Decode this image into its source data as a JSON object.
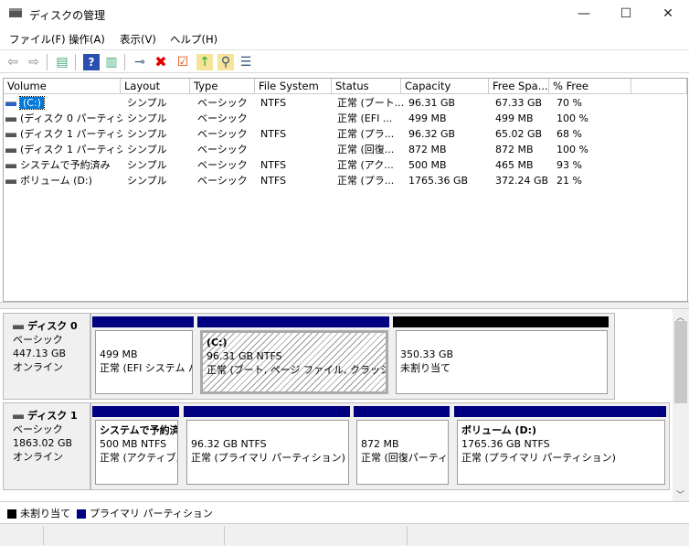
{
  "window": {
    "title": "ディスクの管理",
    "minimize": "—",
    "maximize": "☐",
    "close": "✕"
  },
  "menu": [
    "ファイル(F)",
    "操作(A)",
    "表示(V)",
    "ヘルプ(H)"
  ],
  "toolbar": {
    "icons": [
      "back-icon",
      "forward-icon",
      "console-tree-icon",
      "help-icon",
      "action-pane-icon",
      "connect-icon",
      "delete-icon",
      "properties-icon",
      "import-icon",
      "search-icon",
      "list-icon"
    ]
  },
  "columns": [
    "Volume",
    "Layout",
    "Type",
    "File System",
    "Status",
    "Capacity",
    "Free Spa...",
    "% Free"
  ],
  "volumes": [
    {
      "volume": "(C:)",
      "layout": "シンプル",
      "type": "ベーシック",
      "fs": "NTFS",
      "status": "正常 (ブート...",
      "capacity": "96.31 GB",
      "free": "67.33 GB",
      "pct": "70 %",
      "selected": true
    },
    {
      "volume": "(ディスク 0 パーティシ...",
      "layout": "シンプル",
      "type": "ベーシック",
      "fs": "",
      "status": "正常 (EFI ...",
      "capacity": "499 MB",
      "free": "499 MB",
      "pct": "100 %"
    },
    {
      "volume": "(ディスク 1 パーティシ...",
      "layout": "シンプル",
      "type": "ベーシック",
      "fs": "NTFS",
      "status": "正常 (プラ...",
      "capacity": "96.32 GB",
      "free": "65.02 GB",
      "pct": "68 %"
    },
    {
      "volume": "(ディスク 1 パーティシ...",
      "layout": "シンプル",
      "type": "ベーシック",
      "fs": "",
      "status": "正常 (回復...",
      "capacity": "872 MB",
      "free": "872 MB",
      "pct": "100 %"
    },
    {
      "volume": "システムで予約済み",
      "layout": "シンプル",
      "type": "ベーシック",
      "fs": "NTFS",
      "status": "正常 (アク...",
      "capacity": "500 MB",
      "free": "465 MB",
      "pct": "93 %"
    },
    {
      "volume": "ボリューム (D:)",
      "layout": "シンプル",
      "type": "ベーシック",
      "fs": "NTFS",
      "status": "正常 (プラ...",
      "capacity": "1765.36 GB",
      "free": "372.24 GB",
      "pct": "21 %"
    }
  ],
  "disks": [
    {
      "name": "ディスク 0",
      "type": "ベーシック",
      "size": "447.13 GB",
      "state": "オンライン",
      "partitions": [
        {
          "title": "",
          "line1": "499 MB",
          "line2": "正常 (EFI システム パ"
        },
        {
          "title": "(C:)",
          "line1": "96.31 GB NTFS",
          "line2": "正常 (ブート, ページ ファイル, クラッシュ ダン"
        },
        {
          "title": "",
          "line1": "350.33 GB",
          "line2": "未割り当て"
        }
      ]
    },
    {
      "name": "ディスク 1",
      "type": "ベーシック",
      "size": "1863.02 GB",
      "state": "オンライン",
      "partitions": [
        {
          "title": "システムで予約済",
          "line1": "500 MB NTFS",
          "line2": "正常 (アクティブ, ﾌ"
        },
        {
          "title": "",
          "line1": "96.32 GB NTFS",
          "line2": "正常 (プライマリ パーティション)"
        },
        {
          "title": "",
          "line1": "872 MB",
          "line2": "正常 (回復パーティ"
        },
        {
          "title": "ボリューム (D:)",
          "line1": "1765.36 GB NTFS",
          "line2": "正常 (プライマリ パーティション)"
        }
      ]
    }
  ],
  "legend": [
    {
      "label": "未割り当て",
      "color": "#000000"
    },
    {
      "label": "プライマリ パーティション",
      "color": "#000080"
    }
  ],
  "colors": {
    "primary": "#000080",
    "unallocated": "#000000",
    "selection": "#0078d7"
  }
}
